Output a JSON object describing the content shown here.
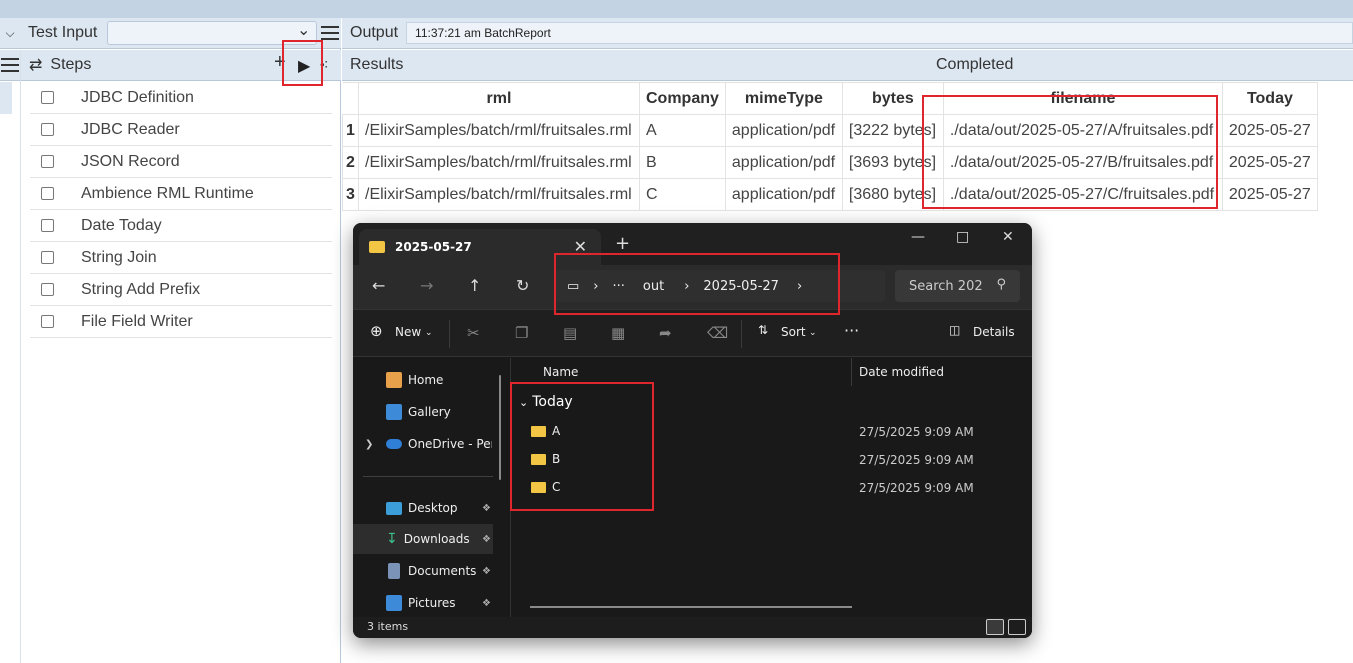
{
  "left_panel": {
    "test_input_label": "Test Input",
    "steps_label": "Steps",
    "steps": [
      "JDBC Definition",
      "JDBC Reader",
      "JSON Record",
      "Ambience RML Runtime",
      "Date Today",
      "String Join",
      "String Add Prefix",
      "File Field Writer"
    ]
  },
  "output": {
    "label": "Output",
    "selected": "11:37:21 am BatchReport"
  },
  "results": {
    "label": "Results",
    "status": "Completed",
    "columns": [
      "rml",
      "Company",
      "mimeType",
      "bytes",
      "filename",
      "Today"
    ],
    "rows": [
      {
        "idx": "1",
        "rml": "/ElixirSamples/batch/rml/fruitsales.rml",
        "company": "A",
        "mime": "application/pdf",
        "bytes": "[3222 bytes]",
        "filename": "./data/out/2025-05-27/A/fruitsales.pdf",
        "today": "2025-05-27"
      },
      {
        "idx": "2",
        "rml": "/ElixirSamples/batch/rml/fruitsales.rml",
        "company": "B",
        "mime": "application/pdf",
        "bytes": "[3693 bytes]",
        "filename": "./data/out/2025-05-27/B/fruitsales.pdf",
        "today": "2025-05-27"
      },
      {
        "idx": "3",
        "rml": "/ElixirSamples/batch/rml/fruitsales.rml",
        "company": "C",
        "mime": "application/pdf",
        "bytes": "[3680 bytes]",
        "filename": "./data/out/2025-05-27/C/fruitsales.pdf",
        "today": "2025-05-27"
      }
    ]
  },
  "explorer": {
    "tab_title": "2025-05-27",
    "breadcrumb": [
      "out",
      "2025-05-27"
    ],
    "search_placeholder": "Search 202",
    "cmd": {
      "new": "New",
      "sort": "Sort",
      "details": "Details"
    },
    "nav": {
      "home": "Home",
      "gallery": "Gallery",
      "onedrive": "OneDrive - Perso",
      "desktop": "Desktop",
      "downloads": "Downloads",
      "documents": "Documents",
      "pictures": "Pictures"
    },
    "col_name": "Name",
    "col_date": "Date modified",
    "group": "Today",
    "files": [
      {
        "name": "A",
        "date": "27/5/2025 9:09 AM"
      },
      {
        "name": "B",
        "date": "27/5/2025 9:09 AM"
      },
      {
        "name": "C",
        "date": "27/5/2025 9:09 AM"
      }
    ],
    "status": "3 items"
  },
  "colors": {
    "highlight": "#e0262d",
    "header_bg": "#dde7f2",
    "folder": "#f3c545"
  }
}
